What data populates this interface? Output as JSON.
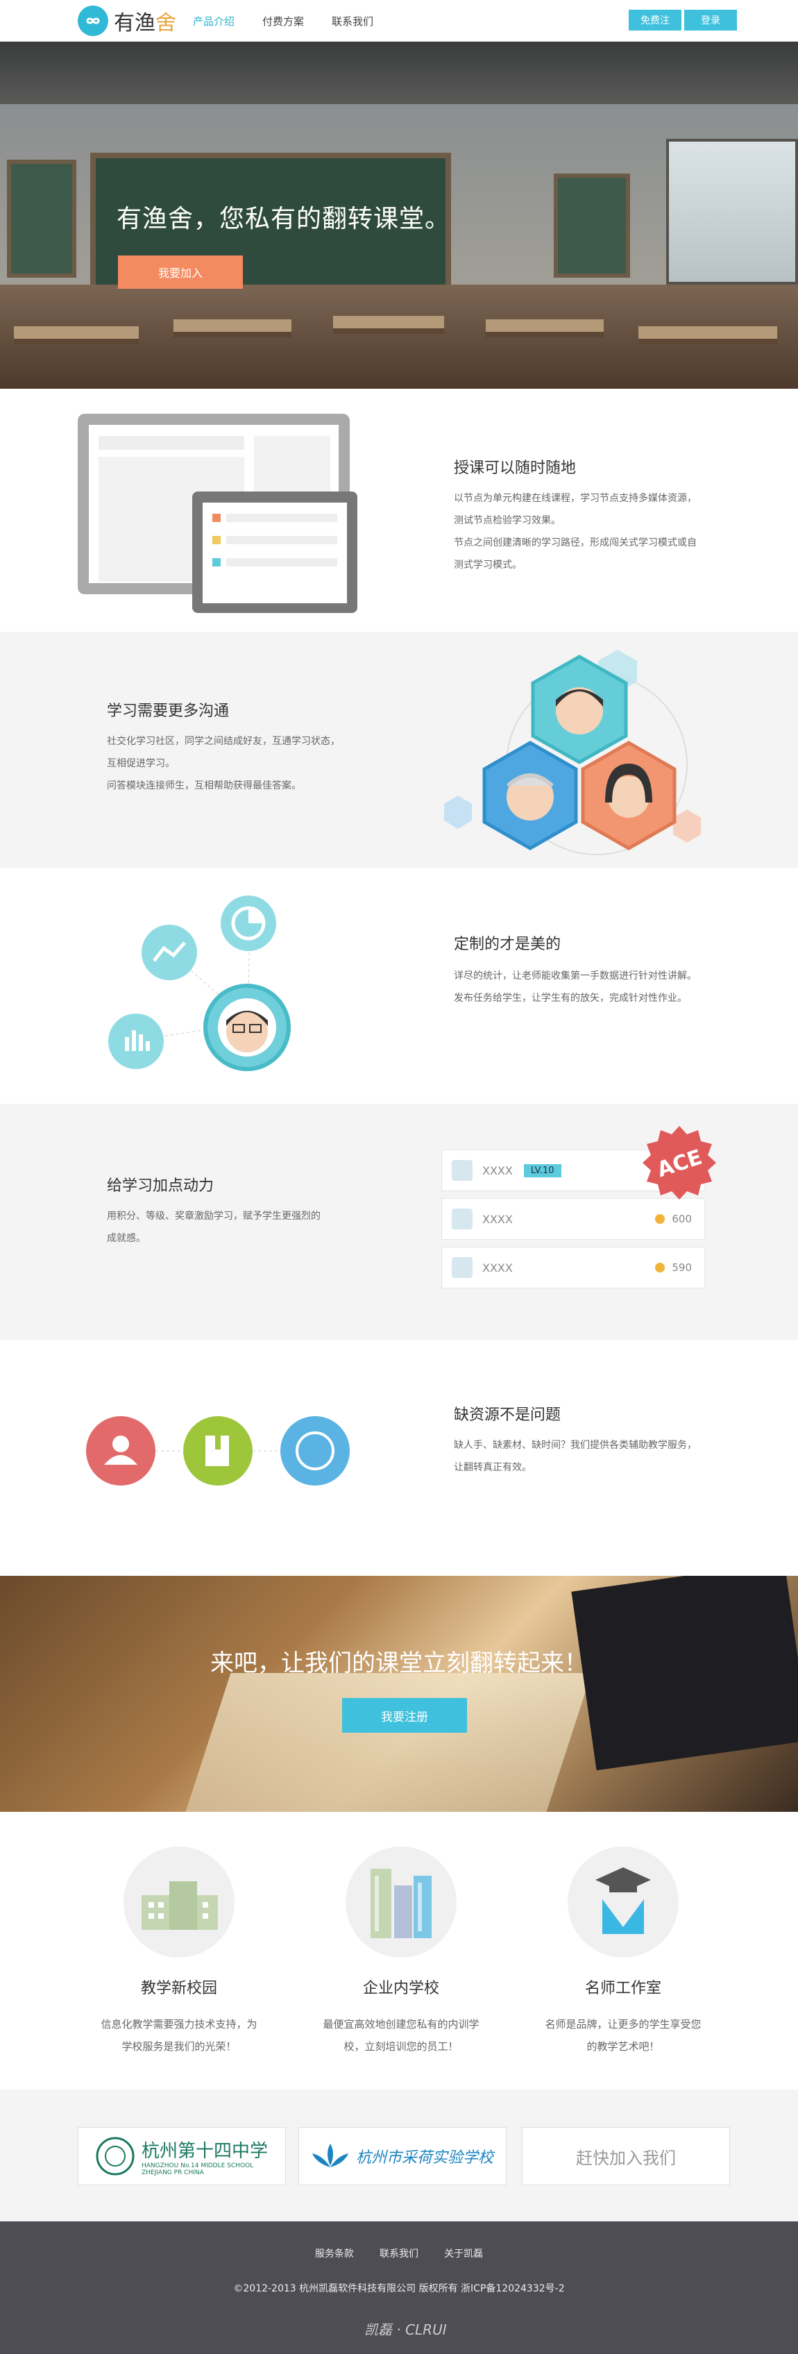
{
  "header": {
    "logo_text_main": "有渔",
    "logo_text_accent": "舍",
    "nav": [
      {
        "label": "产品介绍"
      },
      {
        "label": "付费方案"
      },
      {
        "label": "联系我们"
      }
    ],
    "register_label": "免费注册",
    "login_label": "登录"
  },
  "hero": {
    "title": "有渔舍，您私有的翻转课堂。",
    "join_label": "我要加入"
  },
  "features": [
    {
      "title": "授课可以随时随地",
      "lines": [
        "以节点为单元构建在线课程，学习节点支持多媒体资源，",
        "测试节点检验学习效果。",
        "节点之间创建清晰的学习路径，形成闯关式学习模式或自",
        "测式学习模式。"
      ]
    },
    {
      "title": "学习需要更多沟通",
      "lines": [
        "社交化学习社区，同学之间结成好友，互通学习状态，",
        "互相促进学习。",
        "问答模块连接师生，互相帮助获得最佳答案。"
      ]
    },
    {
      "title": "定制的才是美的",
      "lines": [
        "详尽的统计，让老师能收集第一手数据进行针对性讲解。",
        "发布任务给学生，让学生有的放矢，完成针对性作业。"
      ]
    },
    {
      "title": "给学习加点动力",
      "lines": [
        "用积分、等级、奖章激励学习，赋予学生更强烈的",
        "成就感。"
      ]
    },
    {
      "title": "缺资源不是问题",
      "lines": [
        "缺人手、缺素材、缺时间？我们提供各类辅助教学服务，",
        "让翻转真正有效。"
      ]
    }
  ],
  "leaderboard": [
    {
      "name": "XXXX",
      "level": "LV.10",
      "score": ""
    },
    {
      "name": "XXXX",
      "level": "",
      "score": "600"
    },
    {
      "name": "XXXX",
      "level": "",
      "score": "590"
    }
  ],
  "ace_badge": "ACE",
  "cta": {
    "title": "来吧，让我们的课堂立刻翻转起来！",
    "register_label": "我要注册"
  },
  "categories": [
    {
      "title": "教学新校园",
      "lines": [
        "信息化教学需要强力技术支持，为",
        "学校服务是我们的光荣！"
      ]
    },
    {
      "title": "企业内学校",
      "lines": [
        "最便宜高效地创建您私有的内训学",
        "校，立刻培训您的员工！"
      ]
    },
    {
      "title": "名师工作室",
      "lines": [
        "名师是品牌，让更多的学生享受您",
        "的教学艺术吧！"
      ]
    }
  ],
  "partners": {
    "p1_name": "杭州第十四中学",
    "p1_sub_en": "HANGZHOU No.14 MIDDLE SCHOOL",
    "p1_sub_en2": "ZHEJIANG PR CHINA",
    "p2_name": "杭州市采荷实验学校",
    "p3_label": "赶快加入我们"
  },
  "footer": {
    "links": [
      {
        "label": "服务条款"
      },
      {
        "label": "联系我们"
      },
      {
        "label": "关于凯磊"
      }
    ],
    "copyright": "©2012-2013 杭州凯磊软件科技有限公司 版权所有 浙ICP备12024332号-2",
    "logo_text": "凯磊 · CLRUI"
  },
  "colors": {
    "accent": "#3fc1dd",
    "orange": "#f48a5f",
    "footer_bg": "#4d4d53"
  }
}
